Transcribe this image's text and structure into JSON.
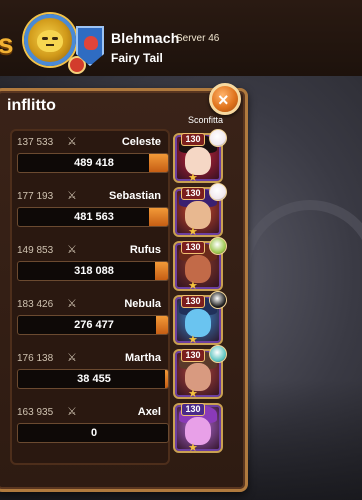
{
  "header": {
    "left_glyph": "s",
    "player_name": "Blehmach",
    "server": "Server 46",
    "guild": "Fairy Tail"
  },
  "panel": {
    "title": "inflitto",
    "column_header": "Sconfitta",
    "close_icon": "×"
  },
  "rows": [
    {
      "power": "137 533",
      "name": "Celeste",
      "damage": "489 418",
      "fill_pct": 0.13,
      "level": "130",
      "portrait_color": "#c7243a",
      "hair_color": "#1a1010",
      "face_color": "#f5d7c5",
      "defeat_color": "#f0e8ee"
    },
    {
      "power": "177 193",
      "name": "Sebastian",
      "damage": "481 563",
      "fill_pct": 0.13,
      "level": "130",
      "portrait_color": "#d04a2a",
      "hair_color": "#3a2070",
      "face_color": "#e8b890",
      "defeat_color": "#f0e8ee"
    },
    {
      "power": "149 853",
      "name": "Rufus",
      "damage": "318 088",
      "fill_pct": 0.09,
      "level": "130",
      "portrait_color": "#8a3a2a",
      "hair_color": "#6a2a1a",
      "face_color": "#c26a48",
      "defeat_color": "#9ac64a"
    },
    {
      "power": "183 426",
      "name": "Nebula",
      "damage": "276 477",
      "fill_pct": 0.08,
      "level": "130",
      "portrait_color": "#3a8ad0",
      "hair_color": "#20305a",
      "face_color": "#6ac4f0",
      "defeat_color": "#1a1a1a"
    },
    {
      "power": "176 138",
      "name": "Martha",
      "damage": "38 455",
      "fill_pct": 0.02,
      "level": "130",
      "portrait_color": "#b0443a",
      "hair_color": "#5a3a2a",
      "face_color": "#d89a80",
      "defeat_color": "#5ac4c0"
    },
    {
      "power": "163 935",
      "name": "Axel",
      "damage": "0",
      "fill_pct": 0.0,
      "level": "130",
      "portrait_color": "#b46ad8",
      "hair_color": "#8a3ab8",
      "face_color": "#e8a0e8",
      "defeat_color": ""
    }
  ],
  "icons": {
    "swords": "⚔",
    "star": "★"
  },
  "colors": {
    "panel_border": "#b07a3e",
    "damage_fill": "#e07a24"
  }
}
